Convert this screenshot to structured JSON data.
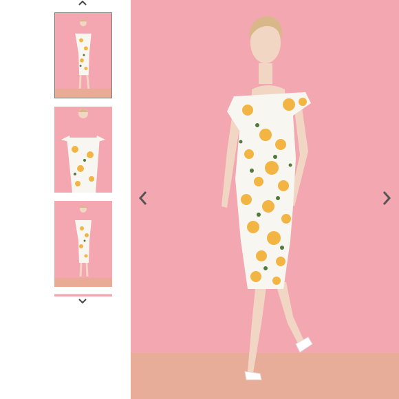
{
  "gallery": {
    "thumbnails": [
      {
        "name": "front-view",
        "active": true
      },
      {
        "name": "close-front-view",
        "active": false
      },
      {
        "name": "back-view",
        "active": false
      }
    ],
    "icons": {
      "thumbs_up": "chevron-up-icon",
      "thumbs_down": "chevron-down-icon",
      "previous": "chevron-left-icon",
      "next": "chevron-right-icon"
    },
    "colors": {
      "backdrop_pink": "#f3a7b0",
      "floor_peach": "#e8ad98",
      "arrow_gray": "#555555",
      "dress_white": "#f8f6f0",
      "rose_yellow": "#f2b544"
    }
  }
}
